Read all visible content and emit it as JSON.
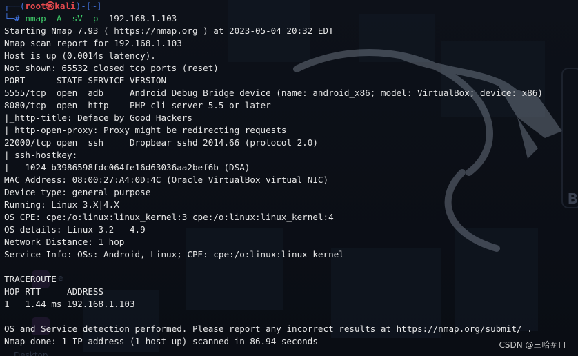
{
  "prompt": {
    "open": "┌──(",
    "user": "root㉿kali",
    "close": ")-[",
    "path": "~",
    "end": "]",
    "branch": "└─",
    "hash": "# ",
    "cmd_name": "nmap",
    "cmd_flags": " -A -sV -p- ",
    "cmd_target": "192.168.1.103"
  },
  "output_lines": [
    "Starting Nmap 7.93 ( https://nmap.org ) at 2023-05-04 20:32 EDT",
    "Nmap scan report for 192.168.1.103",
    "Host is up (0.0014s latency).",
    "Not shown: 65532 closed tcp ports (reset)",
    "PORT      STATE SERVICE VERSION",
    "5555/tcp  open  adb     Android Debug Bridge device (name: android_x86; model: VirtualBox; device: x86)",
    "8080/tcp  open  http    PHP cli server 5.5 or later",
    "|_http-title: Deface by Good Hackers",
    "|_http-open-proxy: Proxy might be redirecting requests",
    "22000/tcp open  ssh     Dropbear sshd 2014.66 (protocol 2.0)",
    "| ssh-hostkey:",
    "|_  1024 b3986598fdc064fe16d63036aa2bef6b (DSA)",
    "MAC Address: 08:00:27:A4:0D:4C (Oracle VirtualBox virtual NIC)",
    "Device type: general purpose",
    "Running: Linux 3.X|4.X",
    "OS CPE: cpe:/o:linux:linux_kernel:3 cpe:/o:linux:linux_kernel:4",
    "OS details: Linux 3.2 - 4.9",
    "Network Distance: 1 hop",
    "Service Info: OSs: Android, Linux; CPE: cpe:/o:linux:linux_kernel",
    "",
    "TRACEROUTE",
    "HOP RTT     ADDRESS",
    "1   1.44 ms 192.168.1.103",
    "",
    "OS and Service detection performed. Please report any incorrect results at https://nmap.org/submit/ .",
    "Nmap done: 1 IP address (1 host up) scanned in 86.94 seconds"
  ],
  "background": {
    "ghost_label_1": "e",
    "ghost_label_2": "Desktop",
    "side_letter": "B"
  },
  "watermark": "CSDN @三哈#TT",
  "colors": {
    "background": "#0b0f17",
    "text": "#e6e6e6",
    "prompt_blue": "#3f6fd6",
    "prompt_red": "#e5494d",
    "command_green": "#3fd06b"
  }
}
